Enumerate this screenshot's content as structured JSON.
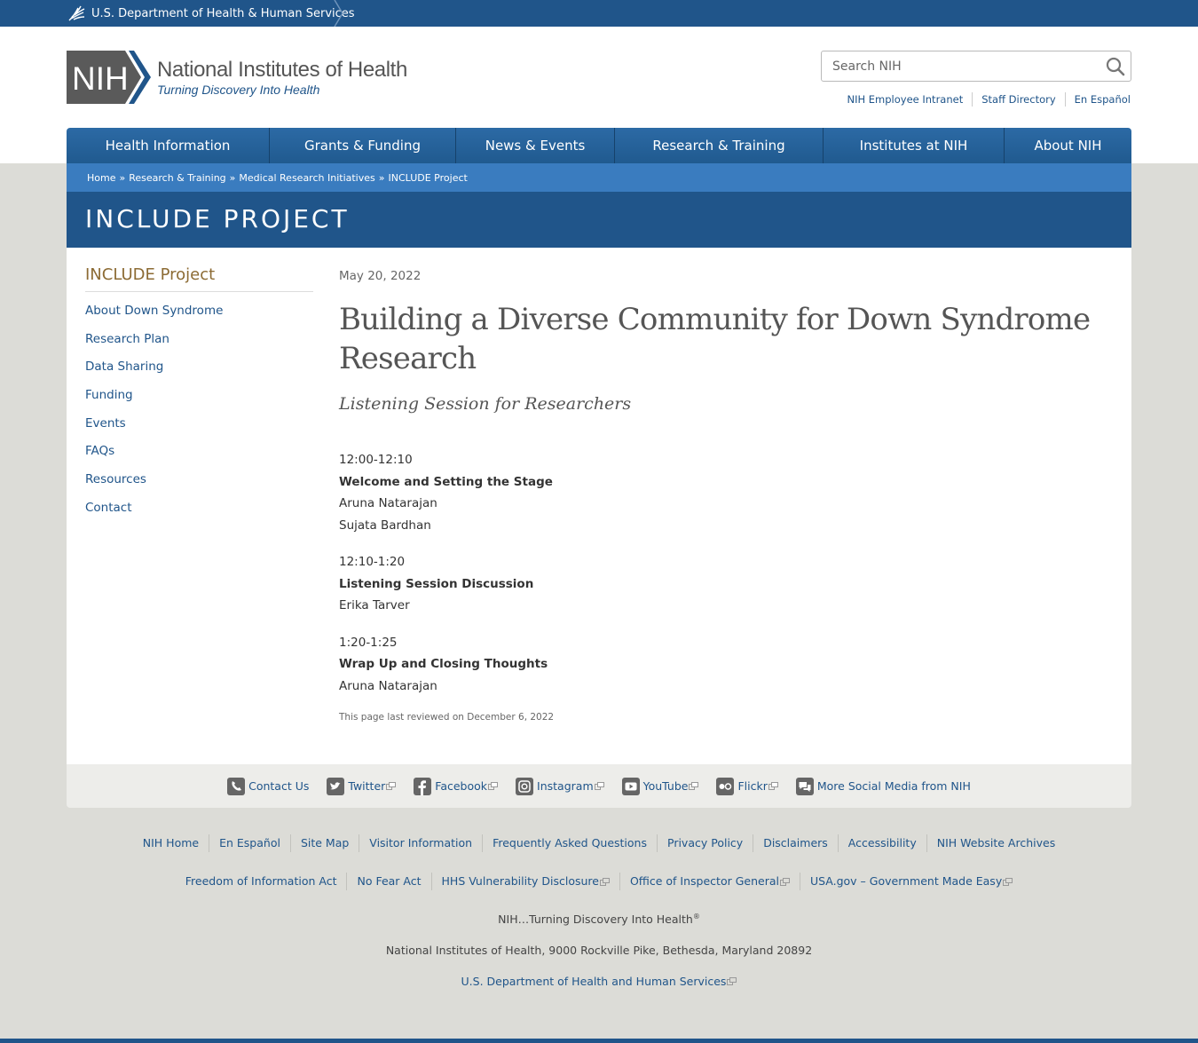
{
  "hhs_bar": {
    "label": "U.S. Department of Health & Human Services"
  },
  "logo": {
    "abbr": "NIH",
    "title": "National Institutes of Health",
    "tagline": "Turning Discovery Into Health"
  },
  "search": {
    "placeholder": "Search NIH"
  },
  "util_links": [
    "NIH Employee Intranet",
    "Staff Directory",
    "En Español"
  ],
  "nav": [
    "Health Information",
    "Grants & Funding",
    "News & Events",
    "Research & Training",
    "Institutes at NIH",
    "About NIH"
  ],
  "breadcrumb": [
    "Home",
    "Research & Training",
    "Medical Research Initiatives",
    "INCLUDE Project"
  ],
  "banner": {
    "title": "INCLUDE PROJECT"
  },
  "sidebar": {
    "title": "INCLUDE Project",
    "items": [
      "About Down Syndrome",
      "Research Plan",
      "Data Sharing",
      "Funding",
      "Events",
      "FAQs",
      "Resources",
      "Contact"
    ]
  },
  "article": {
    "date": "May 20, 2022",
    "headline": "Building a Diverse Community for Down Syndrome Research",
    "subhead": "Listening Session for Researchers",
    "sessions": [
      {
        "time": "12:00-12:10",
        "title": "Welcome and Setting the Stage",
        "speakers": [
          "Aruna Natarajan",
          "Sujata Bardhan"
        ]
      },
      {
        "time": "12:10-1:20",
        "title": "Listening Session Discussion",
        "speakers": [
          "Erika Tarver"
        ]
      },
      {
        "time": "1:20-1:25",
        "title": "Wrap Up and Closing Thoughts",
        "speakers": [
          "Aruna Natarajan"
        ]
      }
    ],
    "reviewed": "This page last reviewed on December 6, 2022"
  },
  "social": [
    {
      "label": "Contact Us",
      "icon": "phone-icon",
      "external": false
    },
    {
      "label": "Twitter",
      "icon": "twitter-icon",
      "external": true
    },
    {
      "label": "Facebook",
      "icon": "facebook-icon",
      "external": true
    },
    {
      "label": "Instagram",
      "icon": "instagram-icon",
      "external": true
    },
    {
      "label": "YouTube",
      "icon": "youtube-icon",
      "external": true
    },
    {
      "label": "Flickr",
      "icon": "flickr-icon",
      "external": true
    },
    {
      "label": "More Social Media from NIH",
      "icon": "chat-icon",
      "external": false
    }
  ],
  "footer": {
    "row1": [
      "NIH Home",
      "En Español",
      "Site Map",
      "Visitor Information",
      "Frequently Asked Questions",
      "Privacy Policy",
      "Disclaimers",
      "Accessibility",
      "NIH Website Archives"
    ],
    "row2": [
      {
        "label": "Freedom of Information Act",
        "external": false
      },
      {
        "label": "No Fear Act",
        "external": false
      },
      {
        "label": "HHS Vulnerability Disclosure",
        "external": true
      },
      {
        "label": "Office of Inspector General",
        "external": true
      },
      {
        "label": "USA.gov – Government Made Easy",
        "external": true
      }
    ],
    "tagline": "NIH…Turning Discovery Into Health",
    "tagline_mark": "®",
    "address": "National Institutes of Health, 9000 Rockville Pike, Bethesda, Maryland 20892",
    "hhs_link": "U.S. Department of Health and Human Services"
  },
  "colors": {
    "brand_blue": "#20558a",
    "breadcrumb_blue": "#3a7cbf",
    "sidebar_title": "#8c6b34",
    "page_bg": "#dcdcd7"
  }
}
